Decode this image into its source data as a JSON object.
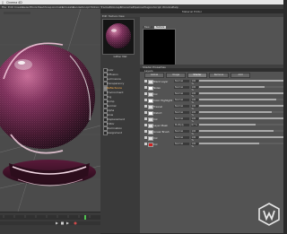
{
  "macos_menu": [
    "Cinema 4D",
    "File",
    "Edit",
    "Create",
    "Select",
    "Tools",
    "Mesh",
    "Snap",
    "Animate",
    "Simulate",
    "Render",
    "Sculpt",
    "Motion Tracker",
    "MoGraph",
    "Character",
    "Pipeline",
    "Plugins",
    "Script",
    "Window",
    "Help"
  ],
  "material_editor": {
    "title": "Material Editor",
    "menu": [
      "Edit",
      "Texture",
      "View"
    ],
    "material_name": "Glitter Mat",
    "texture_tabs": [
      "Basic",
      "Texture"
    ],
    "channels": [
      {
        "label": "Color",
        "checked": false
      },
      {
        "label": "Diffusion",
        "checked": false
      },
      {
        "label": "Luminance",
        "checked": false
      },
      {
        "label": "Transparency",
        "checked": false
      },
      {
        "label": "Reflectance",
        "checked": true,
        "selected": true
      },
      {
        "label": "Environment",
        "checked": false
      },
      {
        "label": "Fog",
        "checked": false
      },
      {
        "label": "Bump",
        "checked": false
      },
      {
        "label": "Normal",
        "checked": false
      },
      {
        "label": "Alpha",
        "checked": false
      },
      {
        "label": "Glow",
        "checked": false
      },
      {
        "label": "Displacement",
        "checked": false
      },
      {
        "label": "Editor",
        "checked": false
      },
      {
        "label": "Illumination",
        "checked": false
      },
      {
        "label": "Assignment",
        "checked": false
      }
    ],
    "shader_header": "Shader Properties",
    "section": "Layers",
    "tabs": [
      "Global",
      "Image",
      "Shader",
      "Remove",
      "Add"
    ],
    "layers": [
      {
        "name": "Black Layer",
        "mode": "Normal",
        "pct": "100 %",
        "fill": 1.0,
        "swatch": "#e0e0e0"
      },
      {
        "name": "Noise",
        "mode": "Normal",
        "pct": "100 %",
        "fill": 0.78,
        "swatch": "#ffffff"
      },
      {
        "name": "Col",
        "mode": "Normal",
        "pct": "100 %",
        "fill": 1.0,
        "swatch": "#e0e0e0"
      },
      {
        "name": "Color Highlight",
        "mode": "Normal",
        "pct": "100 %",
        "fill": 0.92,
        "swatch": "#ffffff"
      },
      {
        "name": "Fresnel",
        "mode": "Normal",
        "pct": "100 %",
        "fill": 1.0,
        "swatch": "#e0e0e0"
      },
      {
        "name": "Distort",
        "mode": "Normal",
        "pct": "100 %",
        "fill": 0.86,
        "swatch": "#ffffff"
      },
      {
        "name": "Col",
        "mode": "Normal",
        "pct": "100 %",
        "fill": 1.0,
        "swatch": "#e0e0e0"
      },
      {
        "name": "Layer Mask",
        "mode": "Multiply",
        "pct": "67 %",
        "fill": 0.67,
        "swatch": "#e0e0e0"
      },
      {
        "name": "Linear Brush",
        "mode": "Normal",
        "pct": "100 %",
        "fill": 0.88,
        "swatch": "#e0e0e0"
      },
      {
        "name": "Col",
        "mode": "Normal",
        "pct": "100 %",
        "fill": 1.0,
        "swatch": "#e0e0e0"
      },
      {
        "name": "Col",
        "mode": "Normal",
        "pct": "100 %",
        "fill": 0.71,
        "swatch": "#cc2222"
      }
    ]
  },
  "colors": {
    "accent_orange": "#ffb14a",
    "sphere_dark": "#4a1633",
    "sphere_glow": "#cd6b97"
  }
}
